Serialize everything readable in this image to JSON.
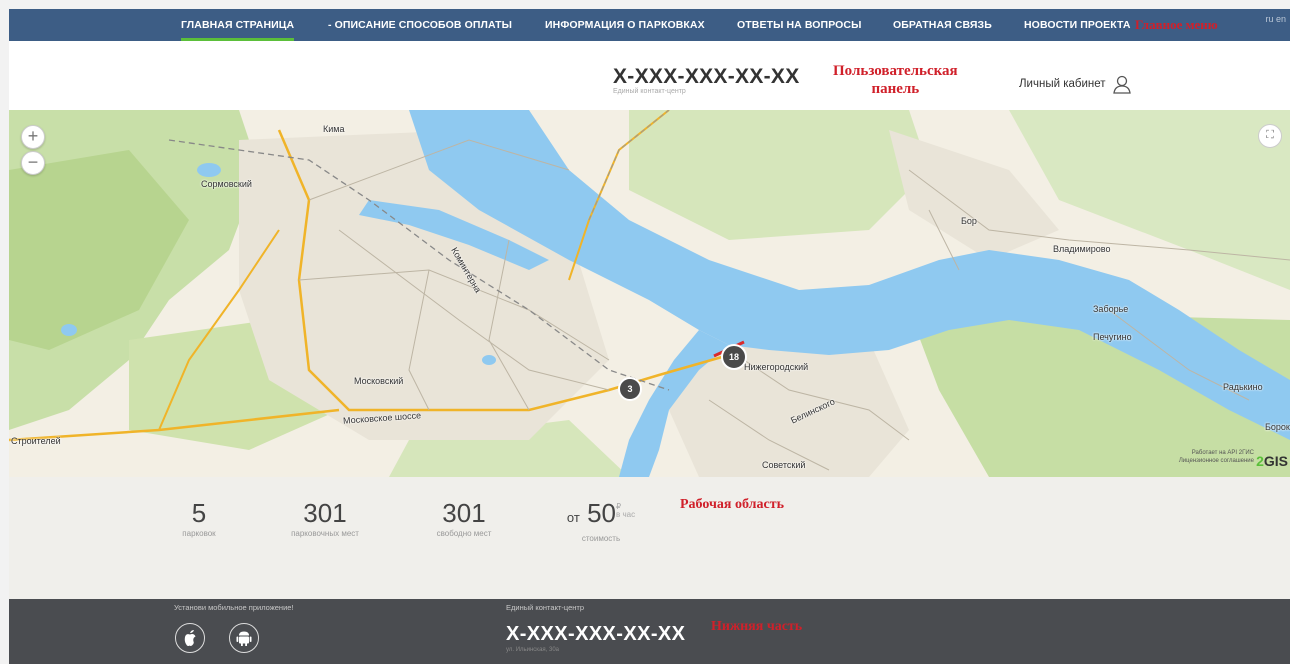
{
  "nav": {
    "items": [
      {
        "label": "ГЛАВНАЯ СТРАНИЦА",
        "active": true
      },
      {
        "label": "- ОПИСАНИЕ СПОСОБОВ ОПЛАТЫ"
      },
      {
        "label": "ИНФОРМАЦИЯ О ПАРКОВКАХ"
      },
      {
        "label": "ОТВЕТЫ НА ВОПРОСЫ"
      },
      {
        "label": "ОБРАТНАЯ СВЯЗЬ"
      },
      {
        "label": "НОВОСТИ ПРОЕКТА"
      }
    ],
    "annotation": "Главное меню",
    "lang": "ru en"
  },
  "header": {
    "phone": "X-XXX-XXX-XX-XX",
    "phone_caption": "Единый контакт-центр",
    "annotation_line1": "Пользовательская",
    "annotation_line2": "панель",
    "cabinet_label": "Личный кабинет"
  },
  "map": {
    "zoom_in": "+",
    "zoom_out": "−",
    "fullscreen": "⛶",
    "labels": {
      "sormovsky": "Сормовский",
      "kima": "Кима",
      "moskovsky": "Московский",
      "moskovskoe_shosse": "Московское шоссе",
      "stroiteley": "Строителей",
      "nizhegorodsky": "Нижегородский",
      "sovetsky": "Советский",
      "bor": "Бор",
      "vladimirovo": "Владимирово",
      "zaborye": "Заборье",
      "pechugino": "Печугино",
      "radkino": "Радькино",
      "borok": "Борок",
      "belinskogo": "Белинского",
      "kominterna": "Коминтерна"
    },
    "clusters": [
      {
        "count": "18"
      },
      {
        "count": "3"
      }
    ],
    "credit_line1": "Работает на API 2ГИС",
    "credit_line2": "Лицензионное соглашение",
    "logo_num": "2",
    "logo_text": "GIS"
  },
  "stats": {
    "items": [
      {
        "value": "5",
        "label": "парковок"
      },
      {
        "value": "301",
        "label": "парковочных мест"
      },
      {
        "value": "301",
        "label": "свободно мест"
      }
    ],
    "price": {
      "prefix": "от",
      "value": "50",
      "currency": "₽",
      "unit": "в час",
      "label": "стоимость"
    },
    "annotation": "Рабочая область"
  },
  "footer": {
    "app_title": "Установи мобильное приложение!",
    "contact_title": "Единый контакт-центр",
    "phone": "X-XXX-XXX-XX-XX",
    "address": "ул. Ильинская, 30а",
    "annotation": "Нижняя часть"
  }
}
